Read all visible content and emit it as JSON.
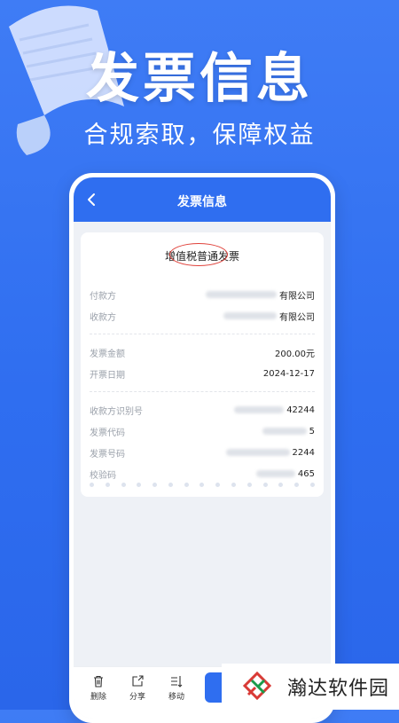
{
  "hero": {
    "title": "发票信息",
    "subtitle": "合规索取，保障权益"
  },
  "app_bar": {
    "title": "发票信息",
    "back_icon": "chevron-left-icon"
  },
  "invoice": {
    "type_title": "增值税普通发票",
    "payer": {
      "label": "付款方",
      "value_suffix": "有限公司"
    },
    "payee": {
      "label": "收款方",
      "value_suffix": "有限公司"
    },
    "amount": {
      "label": "发票金额",
      "value": "200.00元"
    },
    "issue_date": {
      "label": "开票日期",
      "value": "2024-12-17"
    },
    "payee_tax_id": {
      "label": "收款方识别号",
      "value_suffix": "42244"
    },
    "invoice_code": {
      "label": "发票代码",
      "value_suffix": "5"
    },
    "invoice_number": {
      "label": "发票号码",
      "value_suffix": "2244"
    },
    "check_code": {
      "label": "校验码",
      "value_suffix": "465"
    }
  },
  "toolbar": {
    "delete_label": "删除",
    "share_label": "分享",
    "move_label": "移动"
  },
  "watermark": {
    "text": "瀚达软件园"
  },
  "colors": {
    "primary": "#2f6ef0",
    "stamp_red": "#e0413a"
  }
}
